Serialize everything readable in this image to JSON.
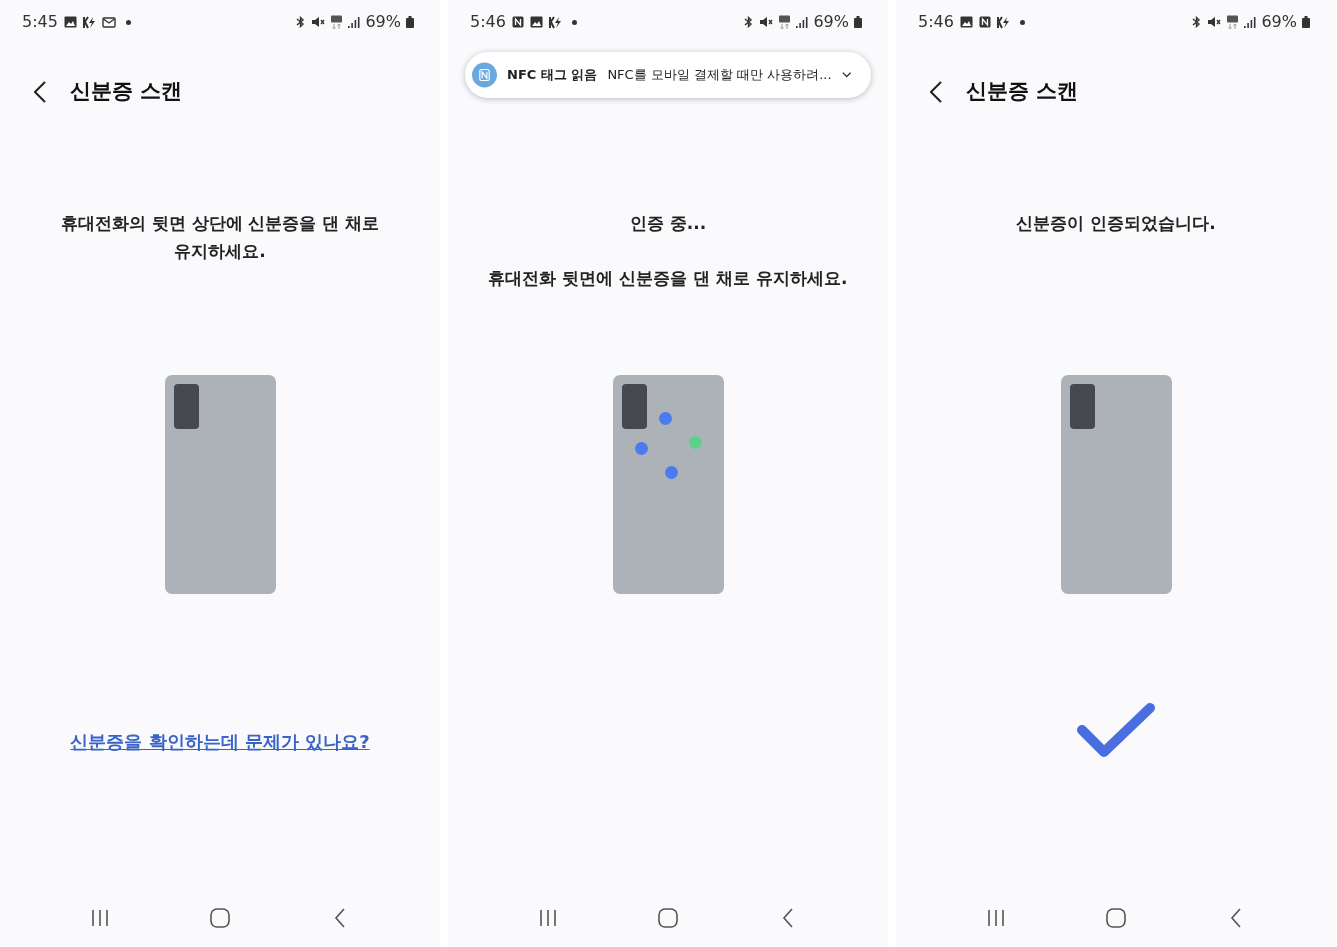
{
  "screens": [
    {
      "status_bar": {
        "time": "5:45",
        "icons": [
          {
            "kind": "image"
          },
          {
            "kind": "charge"
          },
          {
            "kind": "mail"
          },
          {
            "kind": "dot"
          }
        ],
        "battery": "69%"
      },
      "header": {
        "title": "신분증 스캔"
      },
      "messages": [
        "휴대전화의 뒷면 상단에 신분증을 댄 채로 유지하세요."
      ],
      "link": "신분증을 확인하는데 문제가 있나요?",
      "verified": false
    },
    {
      "status_bar": {
        "time": "5:46",
        "icons": [
          {
            "kind": "nfc"
          },
          {
            "kind": "image"
          },
          {
            "kind": "charge"
          },
          {
            "kind": "dot"
          }
        ],
        "battery": "69%"
      },
      "notification": {
        "title": "NFC 태그 읽음",
        "text": "NFC를 모바일 결제할 때만 사용하려..."
      },
      "messages": [
        "인증 중...",
        "휴대전화 뒷면에 신분증을 댄 채로 유지하세요."
      ],
      "dots": [
        {
          "color": "#4a7cf0"
        },
        {
          "color": "#5fd08a"
        },
        {
          "color": "#4a7cf0"
        },
        {
          "color": "#4a7cf0"
        }
      ],
      "verified": false
    },
    {
      "status_bar": {
        "time": "5:46",
        "icons": [
          {
            "kind": "image"
          },
          {
            "kind": "nfc"
          },
          {
            "kind": "charge"
          },
          {
            "kind": "dot"
          }
        ],
        "battery": "69%"
      },
      "header": {
        "title": "신분증 스캔"
      },
      "messages": [
        "신분증이 인증되었습니다."
      ],
      "verified": true
    }
  ]
}
